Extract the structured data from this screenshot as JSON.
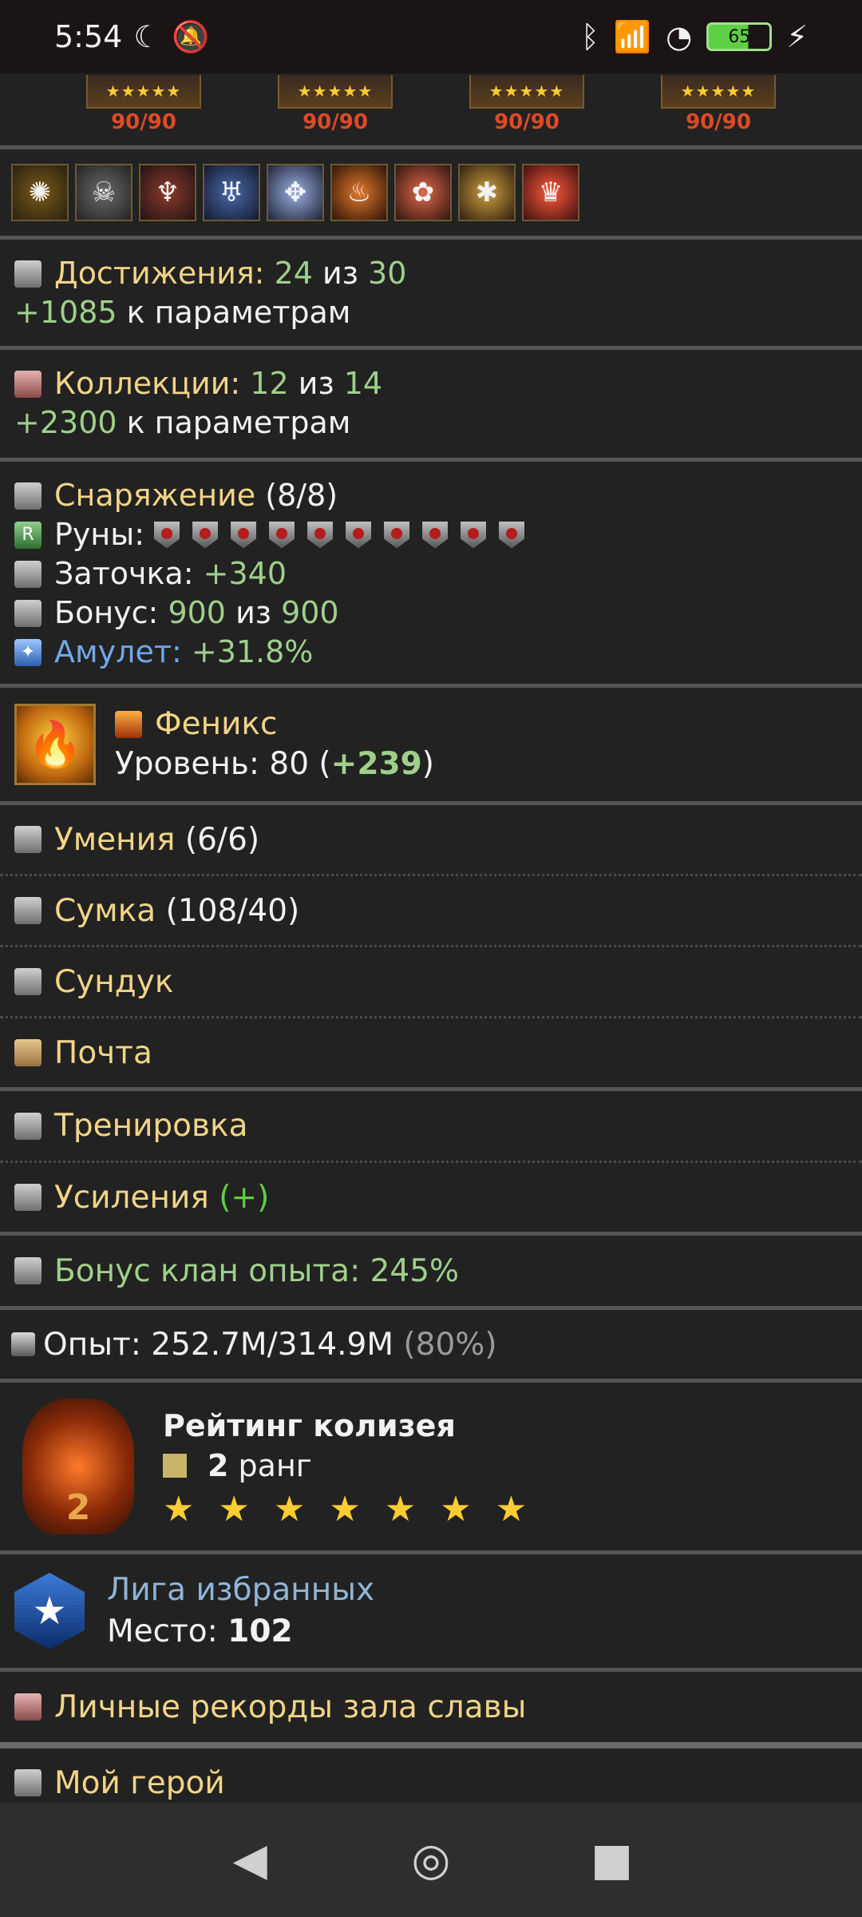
{
  "status": {
    "time": "5:54",
    "battery": "65"
  },
  "gear": {
    "items": [
      {
        "count": "90/90"
      },
      {
        "count": "90/90"
      },
      {
        "count": "90/90"
      },
      {
        "count": "90/90"
      }
    ]
  },
  "achievements": {
    "label": "Достижения:",
    "value": "24",
    "of": "из",
    "total": "30",
    "bonus": "+1085",
    "bonus_suffix": "к параметрам"
  },
  "collections": {
    "label": "Коллекции:",
    "value": "12",
    "of": "из",
    "total": "14",
    "bonus": "+2300",
    "bonus_suffix": "к параметрам"
  },
  "equipment": {
    "label": "Снаряжение",
    "count": "(8/8)",
    "runes_label": "Руны:",
    "sharpen_label": "Заточка:",
    "sharpen_value": "+340",
    "bonus_label": "Бонус:",
    "bonus_value": "900",
    "bonus_of": "из",
    "bonus_total": "900",
    "amulet_label": "Амулет:",
    "amulet_value": "+31.8%"
  },
  "pet": {
    "name": "Феникс",
    "level_label": "Уровень:",
    "level": "80",
    "level_bonus": "+239"
  },
  "menu": {
    "skills_label": "Умения",
    "skills_count": "(6/6)",
    "bag_label": "Сумка",
    "bag_count": "(108/40)",
    "chest_label": "Сундук",
    "mail_label": "Почта",
    "training_label": "Тренировка",
    "boosts_label": "Усиления",
    "boosts_extra": "(+)",
    "clan_bonus": "Бонус клан опыта: 245%"
  },
  "experience": {
    "label": "Опыт:",
    "value": "252.7M/314.9M",
    "percent": "(80%)"
  },
  "colosseum": {
    "title": "Рейтинг колизея",
    "rank_number": "2",
    "rank_word": "ранг",
    "badge_number": "2",
    "stars": 7
  },
  "league": {
    "title": "Лига избранных",
    "place_label": "Место:",
    "place_value": "102"
  },
  "records": {
    "label": "Личные рекорды зала славы"
  },
  "hero": {
    "label": "Мой герой"
  }
}
